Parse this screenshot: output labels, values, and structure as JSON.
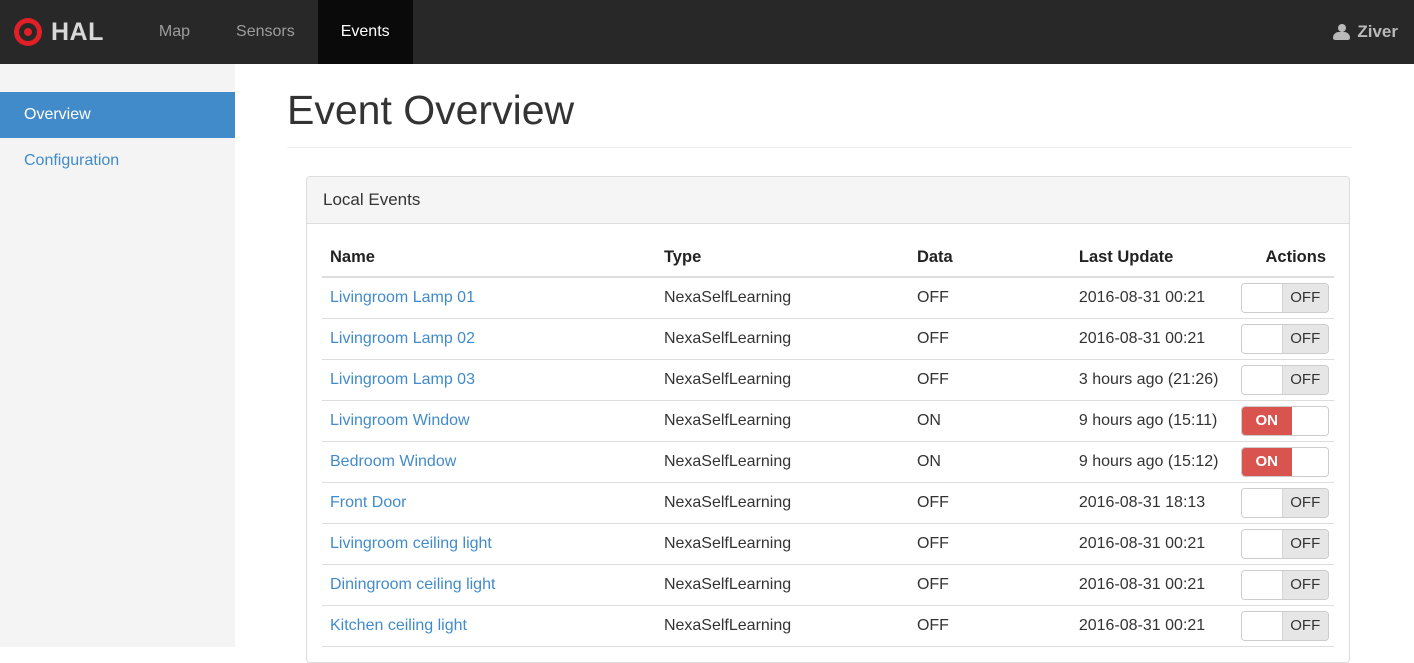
{
  "navbar": {
    "brand": "HAL",
    "items": [
      {
        "label": "Map",
        "active": false
      },
      {
        "label": "Sensors",
        "active": false
      },
      {
        "label": "Events",
        "active": true
      }
    ],
    "user": "Ziver"
  },
  "sidebar": {
    "items": [
      {
        "label": "Overview",
        "active": true
      },
      {
        "label": "Configuration",
        "active": false
      }
    ]
  },
  "page": {
    "title": "Event Overview"
  },
  "panel": {
    "title": "Local Events"
  },
  "table": {
    "columns": [
      "Name",
      "Type",
      "Data",
      "Last Update",
      "Actions"
    ],
    "rows": [
      {
        "name": "Livingroom Lamp 01",
        "type": "NexaSelfLearning",
        "data": "OFF",
        "last_update": "2016-08-31 00:21",
        "toggle": "off"
      },
      {
        "name": "Livingroom Lamp 02",
        "type": "NexaSelfLearning",
        "data": "OFF",
        "last_update": "2016-08-31 00:21",
        "toggle": "off"
      },
      {
        "name": "Livingroom Lamp 03",
        "type": "NexaSelfLearning",
        "data": "OFF",
        "last_update": "3 hours ago (21:26)",
        "toggle": "off"
      },
      {
        "name": "Livingroom Window",
        "type": "NexaSelfLearning",
        "data": "ON",
        "last_update": "9 hours ago (15:11)",
        "toggle": "on"
      },
      {
        "name": "Bedroom Window",
        "type": "NexaSelfLearning",
        "data": "ON",
        "last_update": "9 hours ago (15:12)",
        "toggle": "on"
      },
      {
        "name": "Front Door",
        "type": "NexaSelfLearning",
        "data": "OFF",
        "last_update": "2016-08-31 18:13",
        "toggle": "off"
      },
      {
        "name": "Livingroom ceiling light",
        "type": "NexaSelfLearning",
        "data": "OFF",
        "last_update": "2016-08-31 00:21",
        "toggle": "off"
      },
      {
        "name": "Diningroom ceiling light",
        "type": "NexaSelfLearning",
        "data": "OFF",
        "last_update": "2016-08-31 00:21",
        "toggle": "off"
      },
      {
        "name": "Kitchen ceiling light",
        "type": "NexaSelfLearning",
        "data": "OFF",
        "last_update": "2016-08-31 00:21",
        "toggle": "off"
      }
    ]
  },
  "switch": {
    "on_label": "ON",
    "off_label": "OFF"
  },
  "icons": {
    "brand_logo": "bullseye-icon",
    "user": "person-icon"
  },
  "colors": {
    "navbar_bg": "#282828",
    "navbar_active_bg": "#0a0a0a",
    "navbar_link": "#9d9d9d",
    "brand_red": "#e01f26",
    "sidebar_bg": "#f4f4f4",
    "accent_blue": "#428bca",
    "switch_on_red": "#d9534f",
    "panel_border": "#ddd",
    "panel_heading_bg": "#f5f5f5"
  }
}
